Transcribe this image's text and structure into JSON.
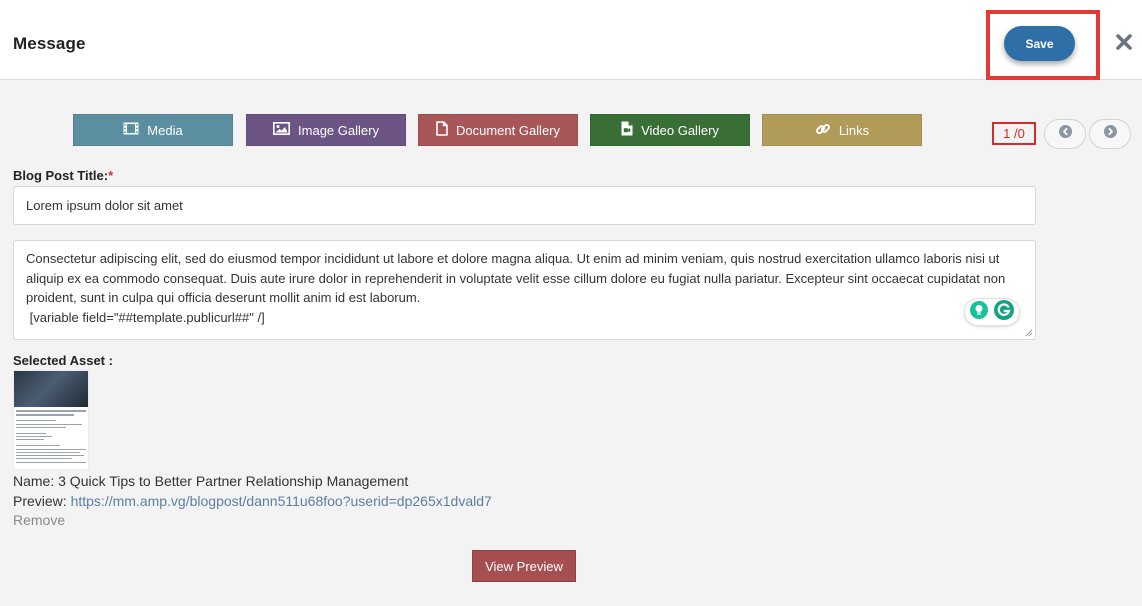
{
  "header": {
    "title": "Message",
    "save_label": "Save"
  },
  "gallery_buttons": {
    "media": "Media",
    "image_gallery": "Image Gallery",
    "document_gallery": "Document Gallery",
    "video_gallery": "Video Gallery",
    "links": "Links"
  },
  "pager": {
    "current": "1",
    "total": "0",
    "separator": "/"
  },
  "form": {
    "title_label": "Blog Post Title:",
    "required_mark": "*",
    "title_value": "Lorem ipsum dolor sit amet",
    "body_text": "Consectetur adipiscing elit, sed do eiusmod tempor incididunt ut labore et dolore magna aliqua. Ut enim ad minim veniam, quis nostrud exercitation ullamco laboris nisi ut aliquip ex ea commodo consequat. Duis aute irure dolor in reprehenderit in voluptate velit esse cillum dolore eu fugiat nulla pariatur. Excepteur sint occaecat cupidatat non proident, sunt in culpa qui officia deserunt mollit anim id est laborum.",
    "body_variable": " [variable field=\"##template.publicurl##\" /]"
  },
  "asset": {
    "label": "Selected Asset :",
    "name_label": "Name:",
    "name_value": "3 Quick Tips to Better Partner Relationship Management",
    "preview_label": "Preview:",
    "preview_url": "https://mm.amp.vg/blogpost/dann511u68foo?userid=dp265x1dvald7",
    "remove_label": "Remove"
  },
  "footer": {
    "view_preview_label": "View Preview"
  },
  "icons": {
    "close": "close-icon",
    "media": "film-icon",
    "image": "image-icon",
    "document": "document-icon",
    "video": "video-file-icon",
    "links": "link-icon",
    "prev": "chevron-left-icon",
    "next": "chevron-right-icon"
  },
  "colors": {
    "save": "#2f6fa8",
    "highlight": "#e53935",
    "media": "#5a8ea0",
    "image_gallery": "#6c5585",
    "document_gallery": "#a85658",
    "video_gallery": "#3a6e37",
    "links": "#b09b58",
    "view_preview": "#a54f50",
    "link_text": "#5b7fa2"
  }
}
